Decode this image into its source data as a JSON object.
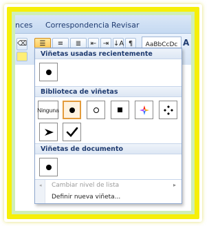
{
  "menubar": {
    "tabs": [
      "nces",
      "Correspondencia",
      "Revisar"
    ]
  },
  "ribbon": {
    "style_preview": "AaBbCcDc",
    "side_letter": "A",
    "paragraph_mark": "¶",
    "sort_icon": "↓A"
  },
  "dropdown": {
    "recent_header": "Viñetas usadas recientemente",
    "library_header": "Biblioteca de viñetas",
    "document_header": "Viñetas de documento",
    "none_label": "Ninguna",
    "library_items": [
      {
        "icon": "none-icon"
      },
      {
        "icon": "filled-circle-bullet-icon",
        "selected": true
      },
      {
        "icon": "hollow-circle-bullet-icon"
      },
      {
        "icon": "square-bullet-icon"
      },
      {
        "icon": "four-diamond-colored-bullet-icon"
      },
      {
        "icon": "four-diamond-bullet-icon"
      },
      {
        "icon": "arrowhead-bullet-icon"
      },
      {
        "icon": "checkmark-bullet-icon"
      }
    ],
    "menu_items": [
      {
        "label": "Cambiar nivel de lista",
        "disabled": true
      },
      {
        "label": "Definir nueva viñeta..."
      }
    ]
  },
  "colors": {
    "frame_yellow": "#f6ef08",
    "frame_green": "#cfeeb8",
    "selection_orange": "#e39b3b",
    "header_text": "#1f3b70"
  }
}
